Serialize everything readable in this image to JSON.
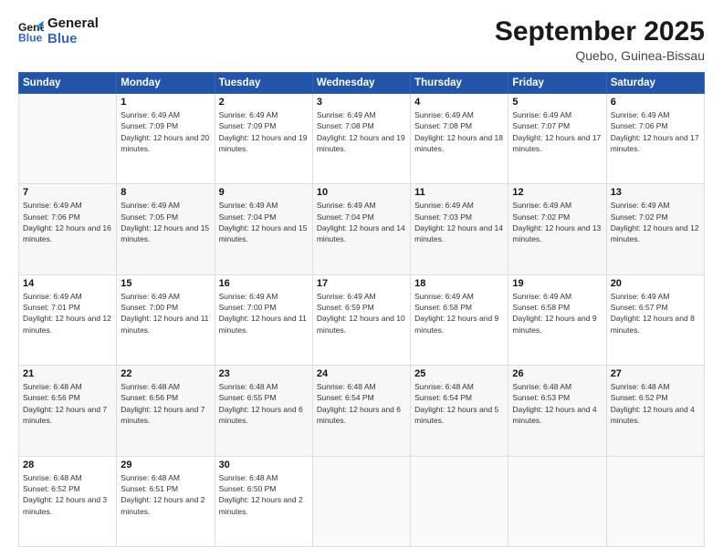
{
  "header": {
    "logo_line1": "General",
    "logo_line2": "Blue",
    "month": "September 2025",
    "location": "Quebo, Guinea-Bissau"
  },
  "weekdays": [
    "Sunday",
    "Monday",
    "Tuesday",
    "Wednesday",
    "Thursday",
    "Friday",
    "Saturday"
  ],
  "weeks": [
    [
      {
        "day": "",
        "sunrise": "",
        "sunset": "",
        "daylight": ""
      },
      {
        "day": "1",
        "sunrise": "6:49 AM",
        "sunset": "7:09 PM",
        "daylight": "12 hours and 20 minutes."
      },
      {
        "day": "2",
        "sunrise": "6:49 AM",
        "sunset": "7:09 PM",
        "daylight": "12 hours and 19 minutes."
      },
      {
        "day": "3",
        "sunrise": "6:49 AM",
        "sunset": "7:08 PM",
        "daylight": "12 hours and 19 minutes."
      },
      {
        "day": "4",
        "sunrise": "6:49 AM",
        "sunset": "7:08 PM",
        "daylight": "12 hours and 18 minutes."
      },
      {
        "day": "5",
        "sunrise": "6:49 AM",
        "sunset": "7:07 PM",
        "daylight": "12 hours and 17 minutes."
      },
      {
        "day": "6",
        "sunrise": "6:49 AM",
        "sunset": "7:06 PM",
        "daylight": "12 hours and 17 minutes."
      }
    ],
    [
      {
        "day": "7",
        "sunrise": "6:49 AM",
        "sunset": "7:06 PM",
        "daylight": "12 hours and 16 minutes."
      },
      {
        "day": "8",
        "sunrise": "6:49 AM",
        "sunset": "7:05 PM",
        "daylight": "12 hours and 15 minutes."
      },
      {
        "day": "9",
        "sunrise": "6:49 AM",
        "sunset": "7:04 PM",
        "daylight": "12 hours and 15 minutes."
      },
      {
        "day": "10",
        "sunrise": "6:49 AM",
        "sunset": "7:04 PM",
        "daylight": "12 hours and 14 minutes."
      },
      {
        "day": "11",
        "sunrise": "6:49 AM",
        "sunset": "7:03 PM",
        "daylight": "12 hours and 14 minutes."
      },
      {
        "day": "12",
        "sunrise": "6:49 AM",
        "sunset": "7:02 PM",
        "daylight": "12 hours and 13 minutes."
      },
      {
        "day": "13",
        "sunrise": "6:49 AM",
        "sunset": "7:02 PM",
        "daylight": "12 hours and 12 minutes."
      }
    ],
    [
      {
        "day": "14",
        "sunrise": "6:49 AM",
        "sunset": "7:01 PM",
        "daylight": "12 hours and 12 minutes."
      },
      {
        "day": "15",
        "sunrise": "6:49 AM",
        "sunset": "7:00 PM",
        "daylight": "12 hours and 11 minutes."
      },
      {
        "day": "16",
        "sunrise": "6:49 AM",
        "sunset": "7:00 PM",
        "daylight": "12 hours and 11 minutes."
      },
      {
        "day": "17",
        "sunrise": "6:49 AM",
        "sunset": "6:59 PM",
        "daylight": "12 hours and 10 minutes."
      },
      {
        "day": "18",
        "sunrise": "6:49 AM",
        "sunset": "6:58 PM",
        "daylight": "12 hours and 9 minutes."
      },
      {
        "day": "19",
        "sunrise": "6:49 AM",
        "sunset": "6:58 PM",
        "daylight": "12 hours and 9 minutes."
      },
      {
        "day": "20",
        "sunrise": "6:49 AM",
        "sunset": "6:57 PM",
        "daylight": "12 hours and 8 minutes."
      }
    ],
    [
      {
        "day": "21",
        "sunrise": "6:48 AM",
        "sunset": "6:56 PM",
        "daylight": "12 hours and 7 minutes."
      },
      {
        "day": "22",
        "sunrise": "6:48 AM",
        "sunset": "6:56 PM",
        "daylight": "12 hours and 7 minutes."
      },
      {
        "day": "23",
        "sunrise": "6:48 AM",
        "sunset": "6:55 PM",
        "daylight": "12 hours and 6 minutes."
      },
      {
        "day": "24",
        "sunrise": "6:48 AM",
        "sunset": "6:54 PM",
        "daylight": "12 hours and 6 minutes."
      },
      {
        "day": "25",
        "sunrise": "6:48 AM",
        "sunset": "6:54 PM",
        "daylight": "12 hours and 5 minutes."
      },
      {
        "day": "26",
        "sunrise": "6:48 AM",
        "sunset": "6:53 PM",
        "daylight": "12 hours and 4 minutes."
      },
      {
        "day": "27",
        "sunrise": "6:48 AM",
        "sunset": "6:52 PM",
        "daylight": "12 hours and 4 minutes."
      }
    ],
    [
      {
        "day": "28",
        "sunrise": "6:48 AM",
        "sunset": "6:52 PM",
        "daylight": "12 hours and 3 minutes."
      },
      {
        "day": "29",
        "sunrise": "6:48 AM",
        "sunset": "6:51 PM",
        "daylight": "12 hours and 2 minutes."
      },
      {
        "day": "30",
        "sunrise": "6:48 AM",
        "sunset": "6:50 PM",
        "daylight": "12 hours and 2 minutes."
      },
      {
        "day": "",
        "sunrise": "",
        "sunset": "",
        "daylight": ""
      },
      {
        "day": "",
        "sunrise": "",
        "sunset": "",
        "daylight": ""
      },
      {
        "day": "",
        "sunrise": "",
        "sunset": "",
        "daylight": ""
      },
      {
        "day": "",
        "sunrise": "",
        "sunset": "",
        "daylight": ""
      }
    ]
  ]
}
